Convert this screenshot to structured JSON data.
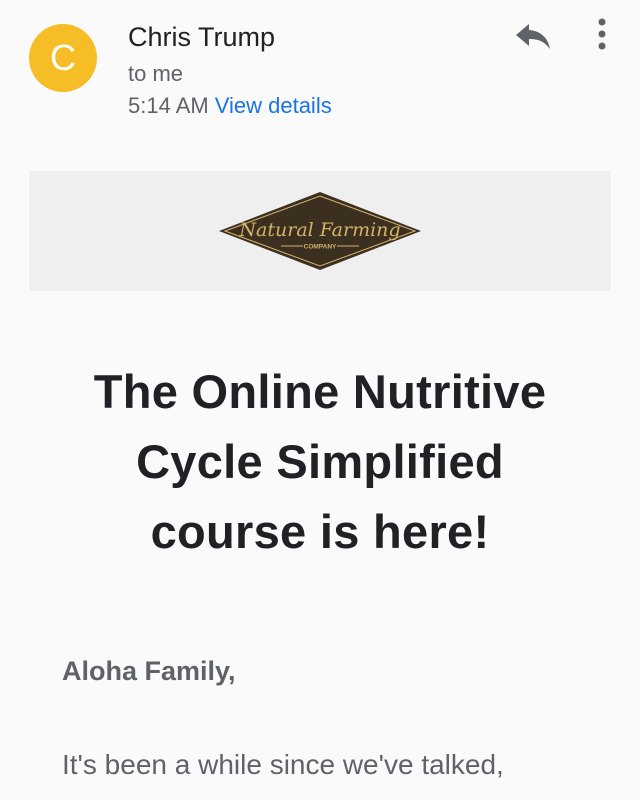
{
  "email": {
    "avatar_letter": "C",
    "sender": "Chris Trump",
    "recipient": "to me",
    "time": "5:14 AM",
    "view_details": "View details"
  },
  "banner": {
    "logo_script": "Natural Farming",
    "logo_sub": "COMPANY"
  },
  "content": {
    "headline_line1": "The Online Nutritive",
    "headline_line2": "Cycle Simplified",
    "headline_line3": "course is here!",
    "greeting": "Aloha Family,",
    "body_line1": "It's been a while since we've talked,"
  },
  "icons": {
    "reply": "reply-icon",
    "more": "more-vertical-icon"
  },
  "colors": {
    "avatar": "#f6bd27",
    "link": "#1a73e8",
    "logo_diamond": "#3b2f20",
    "logo_gold": "#d4b26a"
  }
}
